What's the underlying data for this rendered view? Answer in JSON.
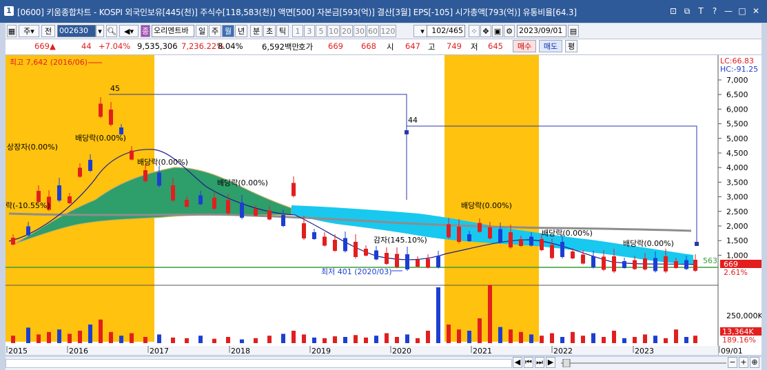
{
  "window": {
    "badge": "1",
    "title": "[0600] 키움종합차트 - KOSPI 외국인보유[445(천)] 주식수[118,583(천)] 액면[500] 자본금[593(억)] 결산[3월] EPS[-105] 시가총액[793(억)] 유통비율[64.3]",
    "buttons": [
      "⊡",
      "⧉",
      "T",
      "?",
      "—",
      "□",
      "✕"
    ]
  },
  "toolbar": {
    "market": "주",
    "all": "전",
    "code": "002630",
    "period_prefix": "종",
    "stock_name": "오리엔트바",
    "periods": [
      "일",
      "주",
      "월",
      "년"
    ],
    "selected_period": "월",
    "intraday": [
      "분",
      "초",
      "틱"
    ],
    "intervals": [
      "1",
      "3",
      "5",
      "10",
      "20",
      "30",
      "60",
      "120"
    ],
    "count": "102/465",
    "date": "2023/09/01"
  },
  "quote": {
    "price": "669",
    "change_sign": "▲",
    "change": "44",
    "change_pct": "+7.04%",
    "volume": "9,535,306",
    "volume_pct": "7,236.22%",
    "turnover": "8.04%",
    "amount": "6,592백만",
    "hoga_label": "호가",
    "ask": "669",
    "bid": "668",
    "open_label": "시",
    "open": "647",
    "high_label": "고",
    "high": "749",
    "low_label": "저",
    "low": "645",
    "buy": "매수",
    "sell": "매도",
    "eval": "평"
  },
  "chart_data": {
    "type": "candlestick",
    "price_axis": [
      "7,000",
      "6,500",
      "6,000",
      "5,500",
      "5,000",
      "4,500",
      "4,000",
      "3,500",
      "3,000",
      "2,500",
      "2,000",
      "1,500",
      "1,000"
    ],
    "volume_axis": [
      "250,000K"
    ],
    "x_labels": [
      "2015",
      "2016",
      "2017",
      "2018",
      "2019",
      "2020",
      "2021",
      "2022",
      "2023",
      "09/01"
    ],
    "annotations": {
      "high": "최고 7,642 (2016/06)",
      "low": "최저 401 (2020/03)",
      "listing": "상장자(0.00%)",
      "dividend": "배당락(0.00%)",
      "reduction": "감자(145.10%)",
      "lc": "LC:66.83",
      "hc": "HC:-91.25",
      "last_price": "669",
      "last_pct": "2.61%",
      "line_price": "563",
      "last_volume": "13,364K",
      "last_volume_pct": "189.16%",
      "label_45": "45",
      "label_44": "44",
      "left_clip": "락(-10.55%)"
    },
    "colors": {
      "up": "#e21e1e",
      "down": "#1c3fd2",
      "cloud_green": "#2e9e6b",
      "cloud_blue": "#19c8ee",
      "highlight": "#ffc20e"
    }
  }
}
